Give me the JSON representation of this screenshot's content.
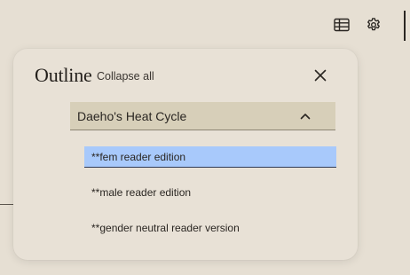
{
  "toolbar": {
    "icons": [
      "table-icon",
      "gear-icon"
    ]
  },
  "outline": {
    "title": "Outline",
    "collapse_label": "Collapse all",
    "close_icon": "close-icon",
    "chapter": {
      "title": "Daeho's Heat Cycle",
      "expanded": true,
      "chevron_icon": "chevron-up-icon"
    },
    "items": [
      {
        "label": "**fem reader edition",
        "active": true
      },
      {
        "label": "**male reader edition",
        "active": false
      },
      {
        "label": "**gender neutral reader version",
        "active": false
      }
    ]
  },
  "colors": {
    "background": "#e6dfd3",
    "panel": "#e8e1d6",
    "chapter_header": "#d7cfb9",
    "active_item": "#a8c9fb",
    "text": "#2a2622"
  }
}
